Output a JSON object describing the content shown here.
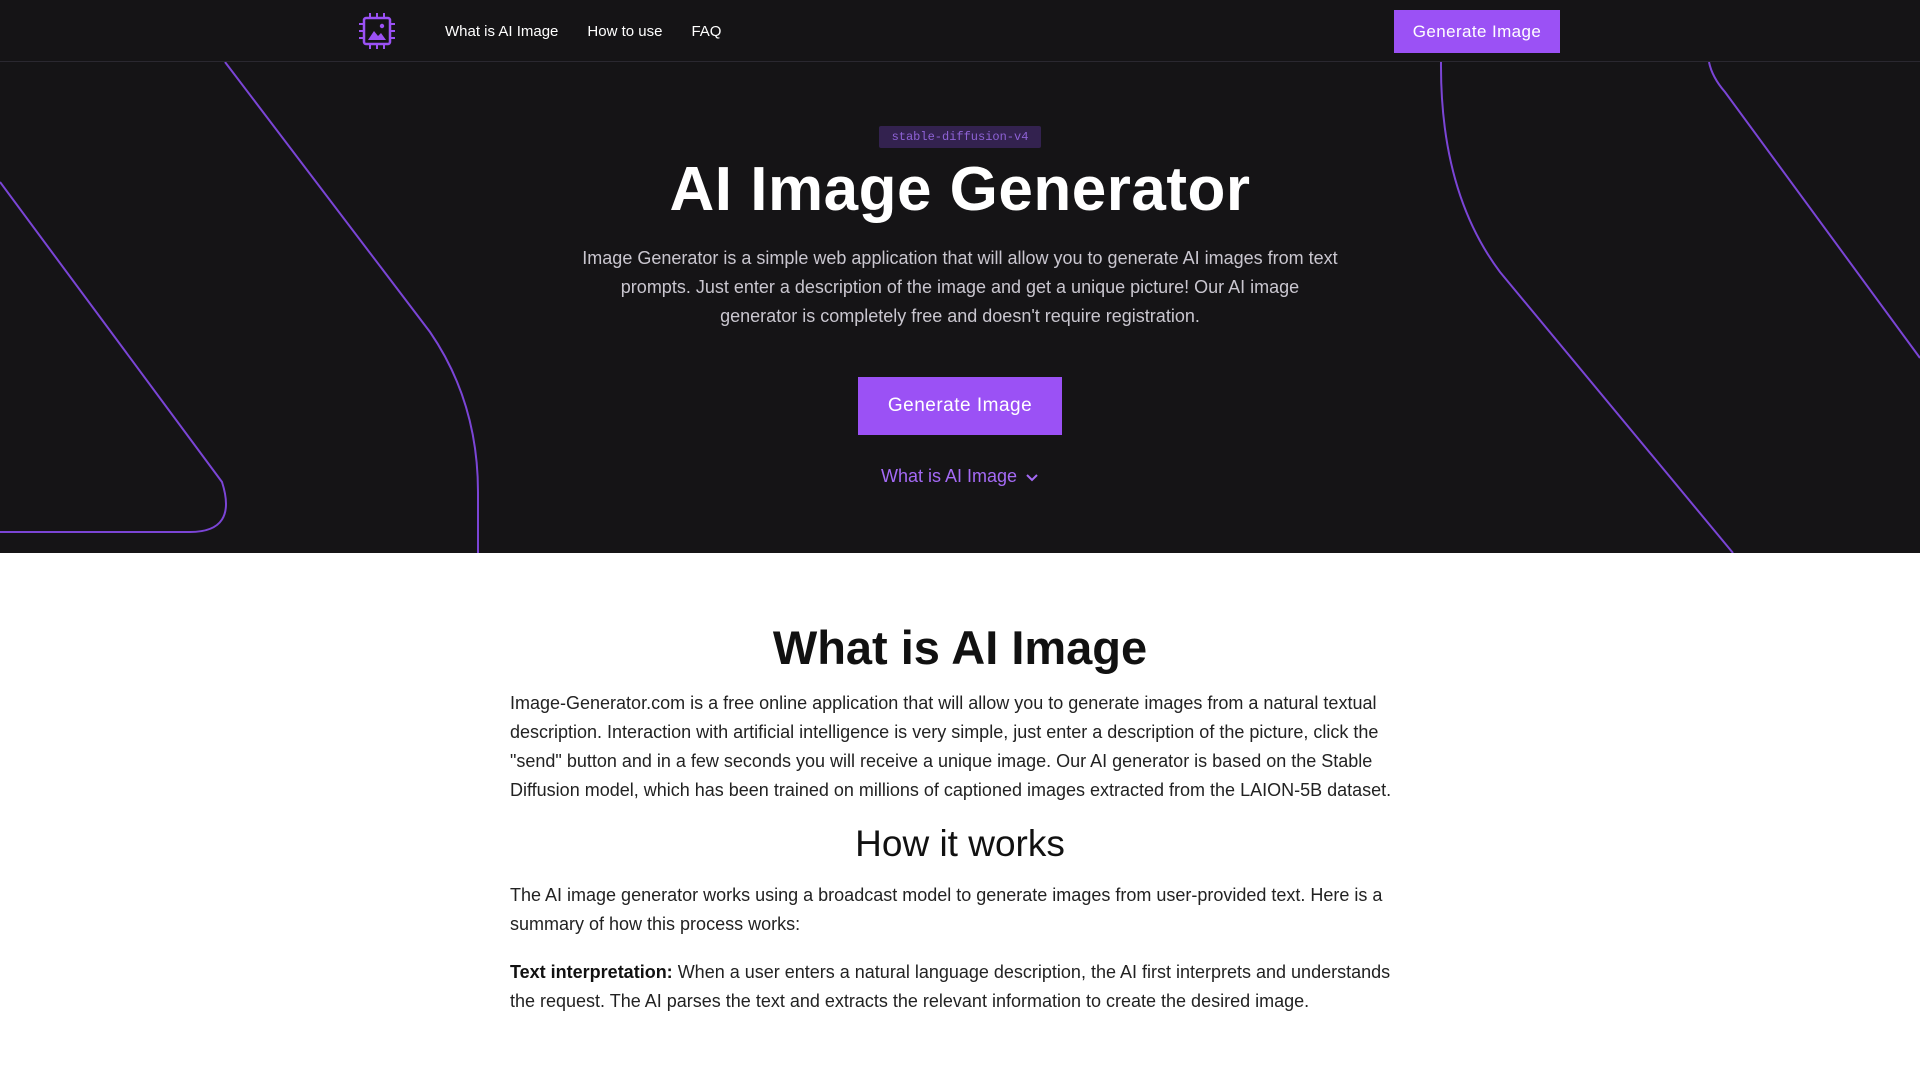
{
  "header": {
    "logo_icon": "chip-image-icon",
    "nav": [
      "What is AI Image",
      "How to use",
      "FAQ"
    ],
    "cta_label": "Generate Image"
  },
  "hero": {
    "badge": "stable-diffusion-v4",
    "title": "AI Image Generator",
    "description": "Image Generator is a simple web application that will allow you to generate AI images from text prompts. Just enter a description of the image and get a unique picture! Our AI image generator is completely free and doesn't require registration.",
    "cta_label": "Generate Image",
    "scroll_link": "What is AI Image",
    "scroll_icon": "chevron-down-icon"
  },
  "section": {
    "title": "What is AI Image",
    "intro": "Image-Generator.com is a free online application that will allow you to generate images from a natural textual description. Interaction with artificial intelligence is very simple, just enter a description of the picture, click the \"send\" button and in a few seconds you will receive a unique image. Our AI generator is based on the Stable Diffusion model, which has been trained on millions of captioned images extracted from the LAION-5B dataset.",
    "how_title": "How it works",
    "how_intro": "The AI image generator works using a broadcast model to generate images from user-provided text. Here is a summary of how this process works:",
    "step_label": "Text interpretation:",
    "step_text": " When a user enters a natural language description, the AI first interprets and understands the request. The AI parses the text and extracts the relevant information to create the desired image."
  },
  "colors": {
    "accent": "#9b51f5",
    "hero_bg": "#151416",
    "link": "#a46af5"
  }
}
